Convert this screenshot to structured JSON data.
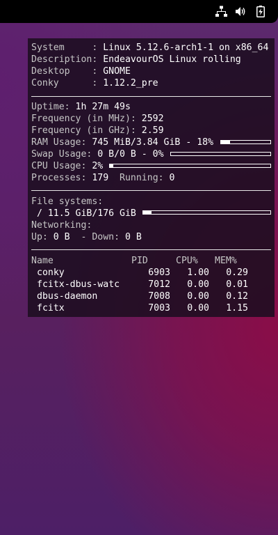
{
  "tray": {
    "icons": [
      "network-icon",
      "volume-icon",
      "battery-charging-icon"
    ]
  },
  "system": [
    {
      "label": "System     : ",
      "value": "Linux 5.12.6-arch1-1 on x86_64"
    },
    {
      "label": "Description: ",
      "value": "EndeavourOS Linux rolling"
    },
    {
      "label": "Desktop    : ",
      "value": "GNOME"
    },
    {
      "label": "Conky      : ",
      "value": "1.12.2_pre"
    }
  ],
  "stats": {
    "uptime_label": "Uptime: ",
    "uptime_value": "1h 27m 49s",
    "freq_mhz_label": "Frequency (in MHz): ",
    "freq_mhz_value": "2592",
    "freq_ghz_label": "Frequency (in GHz): ",
    "freq_ghz_value": "2.59",
    "ram_label": "RAM Usage: ",
    "ram_value": "745 MiB/3.84 GiB - 18%",
    "ram_fraction": 0.18,
    "swap_label": "Swap Usage: ",
    "swap_value": "0 B/0 B - 0%",
    "swap_fraction": 0.0,
    "cpu_label": "CPU Usage: ",
    "cpu_value": "2%",
    "cpu_fraction": 0.02,
    "proc_label": "Processes: ",
    "proc_value": "179",
    "running_label": "  Running: ",
    "running_value": "0"
  },
  "filesystems": {
    "header": "File systems:",
    "root_value": " / 11.5 GiB/176 GiB",
    "root_fraction": 0.065
  },
  "network": {
    "header": "Networking:",
    "up_label": "Up: ",
    "up_value": "0 B",
    "down_label": "  - Down: ",
    "down_value": "0 B"
  },
  "process_table": {
    "headers": [
      "Name",
      "PID",
      "CPU%",
      "MEM%"
    ],
    "rows": [
      [
        "conky",
        "6903",
        "1.00",
        "0.29"
      ],
      [
        "fcitx-dbus-watc",
        "7012",
        "0.00",
        "0.01"
      ],
      [
        "dbus-daemon",
        "7008",
        "0.00",
        "0.12"
      ],
      [
        "fcitx",
        "7003",
        "0.00",
        "1.15"
      ]
    ]
  },
  "colors": {
    "label_gray": "#c6c6c6",
    "value_white": "#ffffff",
    "panel_bg": "#1c0e20"
  }
}
